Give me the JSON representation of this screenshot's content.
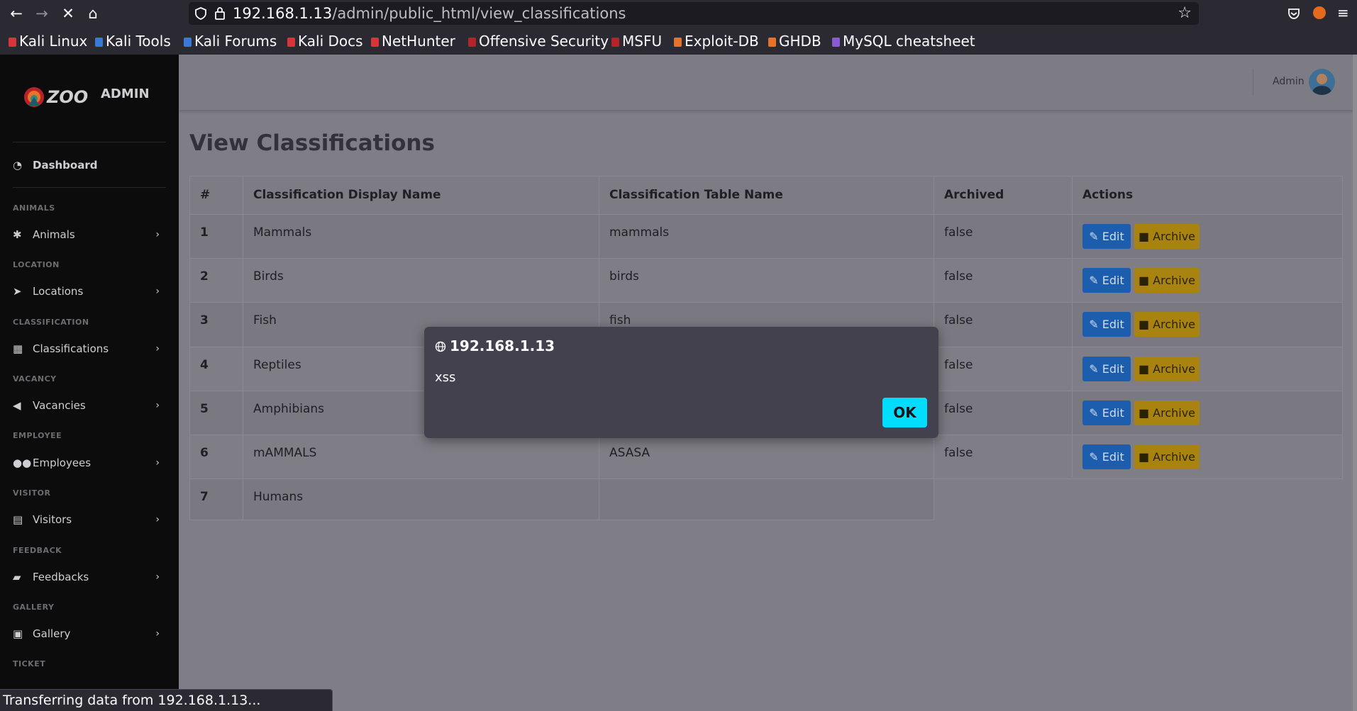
{
  "browser": {
    "url_host": "192.168.1.13",
    "url_path": "/admin/public_html/view_classifications",
    "bookmarks": [
      "Kali Linux",
      "Kali Tools",
      "Kali Forums",
      "Kali Docs",
      "NetHunter",
      "Offensive Security",
      "MSFU",
      "Exploit-DB",
      "GHDB",
      "MySQL cheatsheet"
    ]
  },
  "brand": {
    "logo": "ZOO",
    "admin_label": "ADMIN"
  },
  "sidebar": {
    "dashboard": "Dashboard",
    "sections": [
      {
        "heading": "ANIMALS",
        "item": "Animals",
        "icon": "asterisk-icon"
      },
      {
        "heading": "LOCATION",
        "item": "Locations",
        "icon": "location-arrow-icon"
      },
      {
        "heading": "CLASSIFICATION",
        "item": "Classifications",
        "icon": "grid-icon"
      },
      {
        "heading": "VACANCY",
        "item": "Vacancies",
        "icon": "megaphone-icon"
      },
      {
        "heading": "EMPLOYEE",
        "item": "Employees",
        "icon": "users-icon"
      },
      {
        "heading": "VISITOR",
        "item": "Visitors",
        "icon": "id-card-icon"
      },
      {
        "heading": "FEEDBACK",
        "item": "Feedbacks",
        "icon": "comment-icon"
      },
      {
        "heading": "GALLERY",
        "item": "Gallery",
        "icon": "images-icon"
      }
    ],
    "last_heading": "TICKET"
  },
  "topbar": {
    "user": "Admin"
  },
  "page": {
    "title": "View Classifications"
  },
  "table": {
    "headers": [
      "#",
      "Classification Display Name",
      "Classification Table Name",
      "Archived",
      "Actions"
    ],
    "rows": [
      {
        "num": "1",
        "display": "Mammals",
        "table": "mammals",
        "archived": "false"
      },
      {
        "num": "2",
        "display": "Birds",
        "table": "birds",
        "archived": "false"
      },
      {
        "num": "3",
        "display": "Fish",
        "table": "fish",
        "archived": "false"
      },
      {
        "num": "4",
        "display": "Reptiles",
        "table": "",
        "archived": "false"
      },
      {
        "num": "5",
        "display": "Amphibians",
        "table": "",
        "archived": "false"
      },
      {
        "num": "6",
        "display": "mAMMALS",
        "table": "ASASA",
        "archived": "false"
      },
      {
        "num": "7",
        "display": "Humans",
        "table": "",
        "archived": ""
      }
    ],
    "edit_label": "Edit",
    "archive_label": "Archive"
  },
  "dialog": {
    "origin": "192.168.1.13",
    "message": "xss",
    "ok_label": "OK"
  },
  "status_bar": "Transferring data from 192.168.1.13..."
}
